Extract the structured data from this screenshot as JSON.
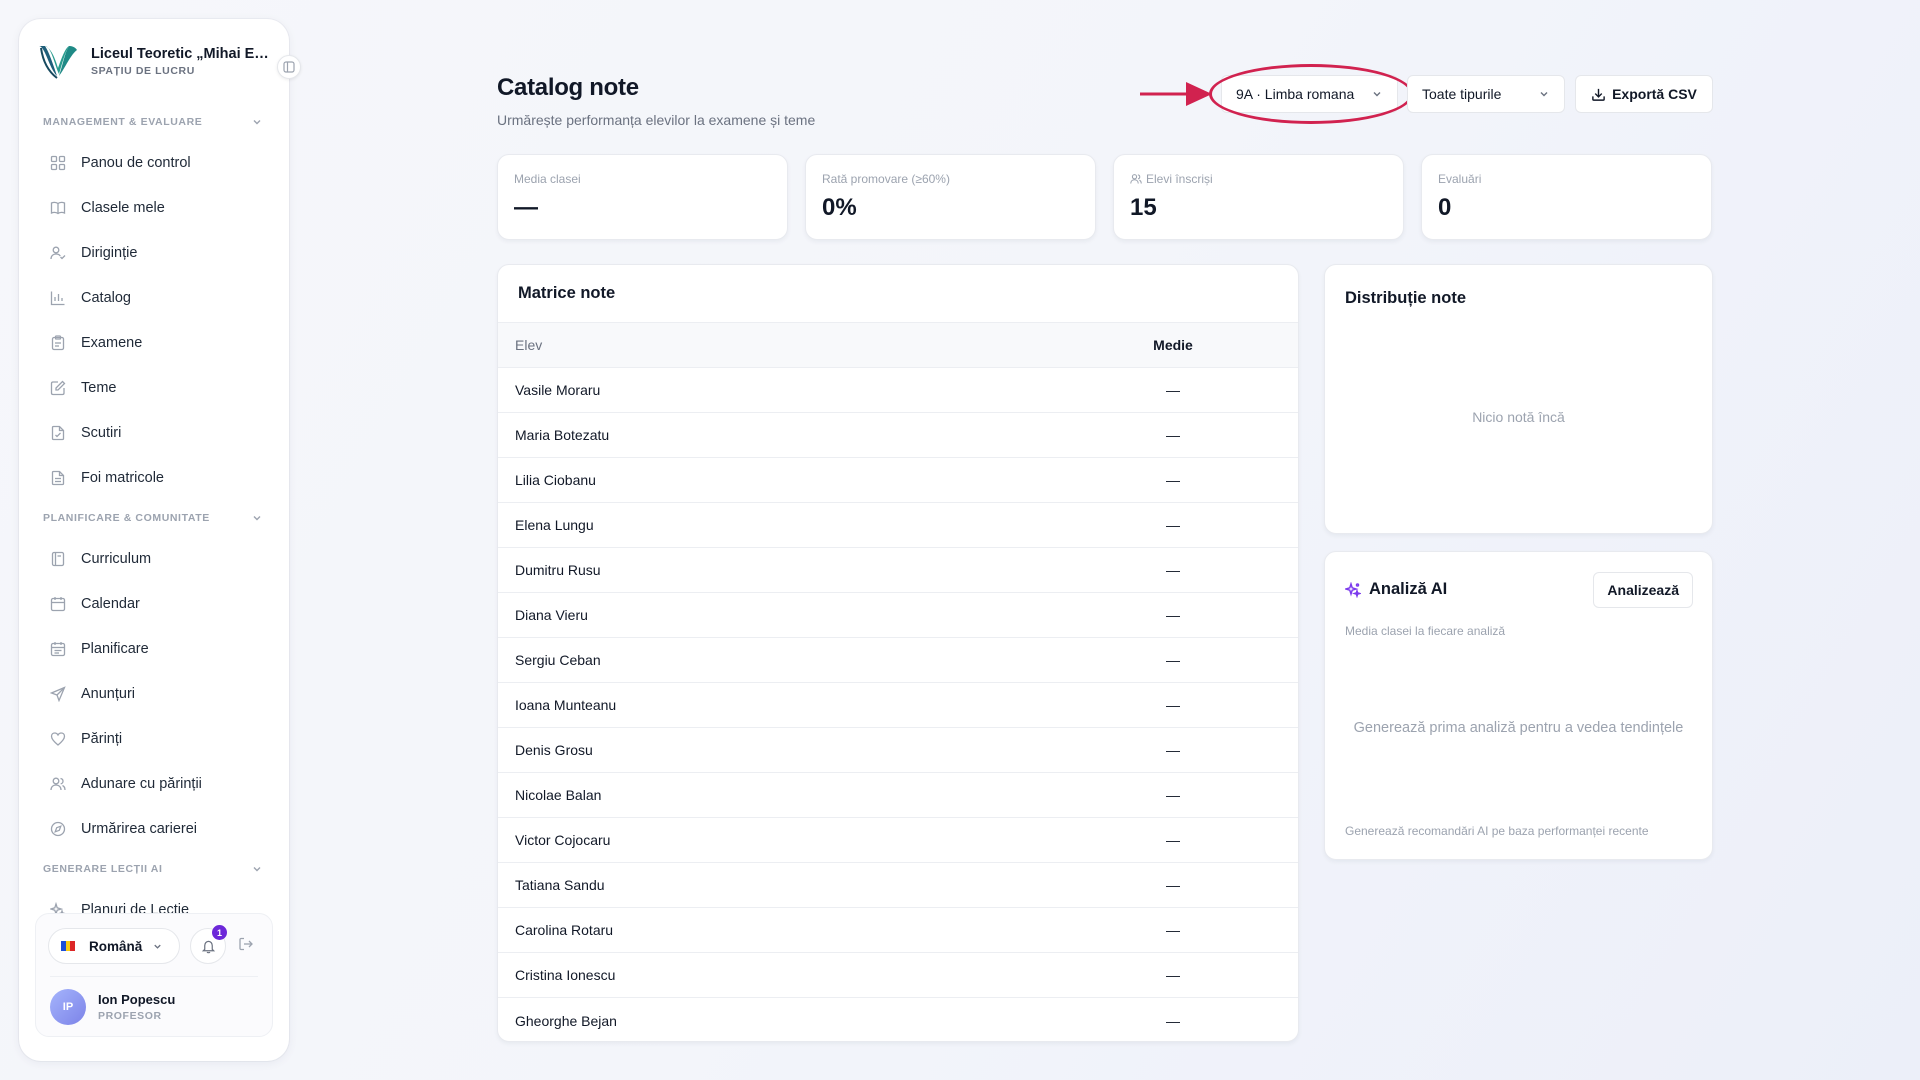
{
  "sidebar": {
    "brand_name": "Liceul Teoretic „Mihai Emi...",
    "brand_sub": "SPAȚIU DE LUCRU",
    "sections": [
      {
        "title": "MANAGEMENT & EVALUARE",
        "items": [
          {
            "label": "Panou de control",
            "icon": "dashboard-icon"
          },
          {
            "label": "Clasele mele",
            "icon": "book-icon"
          },
          {
            "label": "Diriginție",
            "icon": "user-check-icon"
          },
          {
            "label": "Catalog",
            "icon": "bar-chart-icon"
          },
          {
            "label": "Examene",
            "icon": "clipboard-icon"
          },
          {
            "label": "Teme",
            "icon": "edit-icon"
          },
          {
            "label": "Scutiri",
            "icon": "file-check-icon"
          },
          {
            "label": "Foi matricole",
            "icon": "file-text-icon"
          }
        ]
      },
      {
        "title": "PLANIFICARE & COMUNITATE",
        "items": [
          {
            "label": "Curriculum",
            "icon": "notebook-icon"
          },
          {
            "label": "Calendar",
            "icon": "calendar-icon"
          },
          {
            "label": "Planificare",
            "icon": "calendar-plan-icon"
          },
          {
            "label": "Anunțuri",
            "icon": "send-icon"
          },
          {
            "label": "Părinți",
            "icon": "heart-icon"
          },
          {
            "label": "Adunare cu părinții",
            "icon": "users-icon"
          },
          {
            "label": "Urmărirea carierei",
            "icon": "compass-icon"
          }
        ]
      },
      {
        "title": "GENERARE LECȚII AI",
        "items": [
          {
            "label": "Planuri de Lecție",
            "icon": "sparkles-icon"
          }
        ]
      }
    ],
    "footer": {
      "language": "Română",
      "notification_count": "1",
      "user_initials": "IP",
      "user_name": "Ion Popescu",
      "user_role": "PROFESOR"
    }
  },
  "header": {
    "title": "Catalog note",
    "subtitle": "Urmărește performanța elevilor la examene și teme",
    "class_select": "9A · Limba romana",
    "type_select": "Toate tipurile",
    "export_label": "Exportă CSV"
  },
  "stats": [
    {
      "label": "Media clasei",
      "value": "—"
    },
    {
      "label": "Rată promovare (≥60%)",
      "value": "0%"
    },
    {
      "label": "Elevi înscriși",
      "value": "15"
    },
    {
      "label": "Evaluări",
      "value": "0"
    }
  ],
  "matrix": {
    "title": "Matrice note",
    "columns": [
      "Elev",
      "Medie"
    ],
    "rows": [
      {
        "student": "Vasile Moraru",
        "average": "—"
      },
      {
        "student": "Maria Botezatu",
        "average": "—"
      },
      {
        "student": "Lilia Ciobanu",
        "average": "—"
      },
      {
        "student": "Elena Lungu",
        "average": "—"
      },
      {
        "student": "Dumitru Rusu",
        "average": "—"
      },
      {
        "student": "Diana Vieru",
        "average": "—"
      },
      {
        "student": "Sergiu Ceban",
        "average": "—"
      },
      {
        "student": "Ioana Munteanu",
        "average": "—"
      },
      {
        "student": "Denis Grosu",
        "average": "—"
      },
      {
        "student": "Nicolae Balan",
        "average": "—"
      },
      {
        "student": "Victor Cojocaru",
        "average": "—"
      },
      {
        "student": "Tatiana Sandu",
        "average": "—"
      },
      {
        "student": "Carolina Rotaru",
        "average": "—"
      },
      {
        "student": "Cristina Ionescu",
        "average": "—"
      },
      {
        "student": "Gheorghe Bejan",
        "average": "—"
      }
    ]
  },
  "distribution": {
    "title": "Distribuție note",
    "empty": "Nicio notă încă"
  },
  "ai_analysis": {
    "title": "Analiză AI",
    "button": "Analizează",
    "subtitle": "Media clasei la fiecare analiză",
    "empty": "Generează prima analiză pentru a vedea tendințele",
    "footer": "Generează recomandări AI pe baza performanței recente"
  },
  "colors": {
    "accent": "#6d28d9",
    "annotation": "#d1224f",
    "brand_teal": "#1f8a86"
  }
}
